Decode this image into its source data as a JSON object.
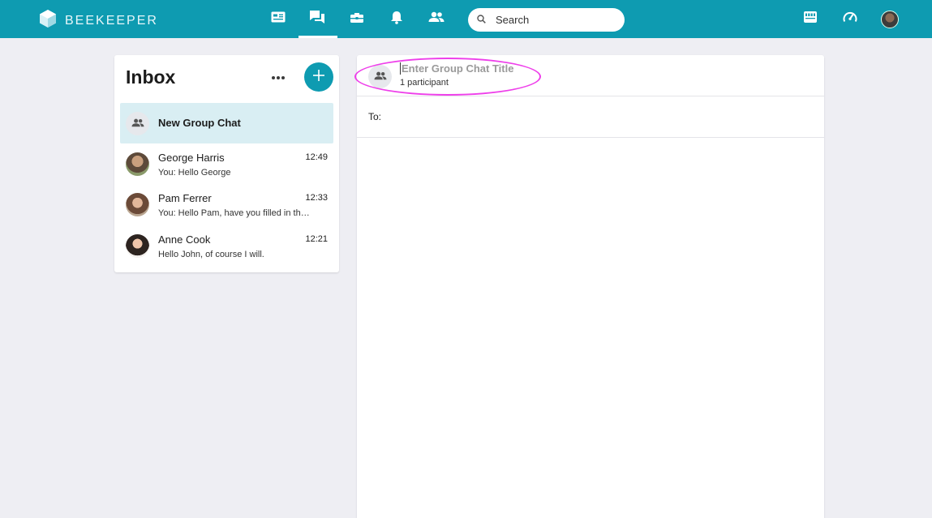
{
  "app": {
    "brand": "BEEKEEPER"
  },
  "topbar": {
    "nav": [
      {
        "name": "nav-streams",
        "icon": "newsfeed-icon",
        "active": false
      },
      {
        "name": "nav-chats",
        "icon": "chat-icon",
        "active": true
      },
      {
        "name": "nav-tools",
        "icon": "toolbox-icon",
        "active": false
      },
      {
        "name": "nav-notifications",
        "icon": "bell-icon",
        "active": false
      },
      {
        "name": "nav-people",
        "icon": "people-icon",
        "active": false
      }
    ],
    "search": {
      "placeholder": "Search"
    },
    "right_icons": [
      "store-icon",
      "dashboard-icon",
      "user-avatar"
    ]
  },
  "inbox": {
    "title": "Inbox",
    "conversations": [
      {
        "name": "New Group Chat",
        "time": "",
        "preview": "",
        "selected": true
      },
      {
        "name": "George Harris",
        "time": "12:49",
        "preview": "You: Hello George"
      },
      {
        "name": "Pam Ferrer",
        "time": "12:33",
        "preview": "You: Hello Pam, have you filled in the form?"
      },
      {
        "name": "Anne Cook",
        "time": "12:21",
        "preview": "Hello John, of course I will."
      }
    ]
  },
  "chat": {
    "title_placeholder": "Enter Group Chat Title",
    "participants": "1 participant",
    "to_label": "To:"
  },
  "colors": {
    "brand": "#0e9bb1",
    "selected_bg": "#d9eef3",
    "highlight": "#ee3fea",
    "page_bg": "#eeeef3"
  }
}
